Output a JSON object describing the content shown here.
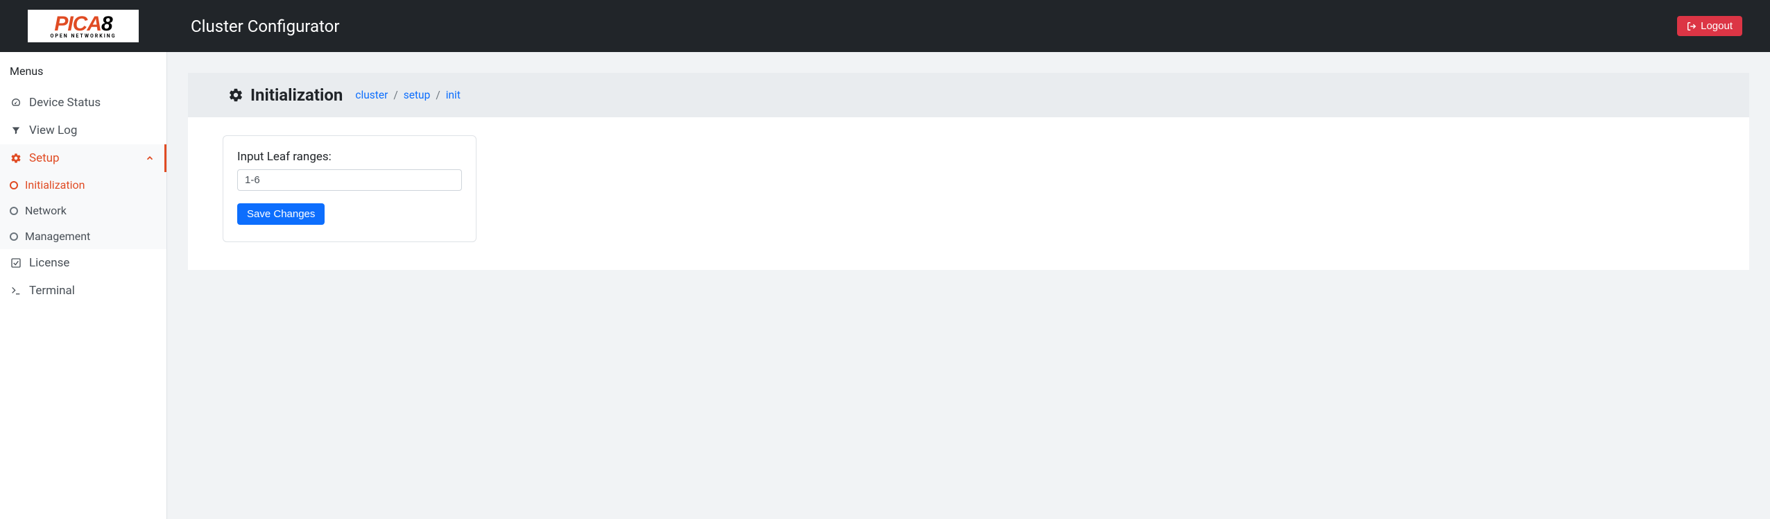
{
  "header": {
    "logo_main": "PICA",
    "logo_accent": "8",
    "logo_sub": "OPEN NETWORKING",
    "app_title": "Cluster Configurator",
    "logout_label": "Logout"
  },
  "sidebar": {
    "header": "Menus",
    "items": [
      {
        "icon": "dashboard-icon",
        "label": "Device Status"
      },
      {
        "icon": "filter-icon",
        "label": "View Log"
      },
      {
        "icon": "gear-icon",
        "label": "Setup",
        "active": true
      },
      {
        "icon": "check-icon",
        "label": "License"
      },
      {
        "icon": "terminal-icon",
        "label": "Terminal"
      }
    ],
    "setup_submenu": [
      {
        "label": "Initialization",
        "active": true
      },
      {
        "label": "Network"
      },
      {
        "label": "Management"
      }
    ]
  },
  "page": {
    "title": "Initialization",
    "breadcrumb": [
      "cluster",
      "setup",
      "init"
    ]
  },
  "form": {
    "leaf_label": "Input Leaf ranges:",
    "leaf_value": "1-6",
    "save_label": "Save Changes"
  }
}
